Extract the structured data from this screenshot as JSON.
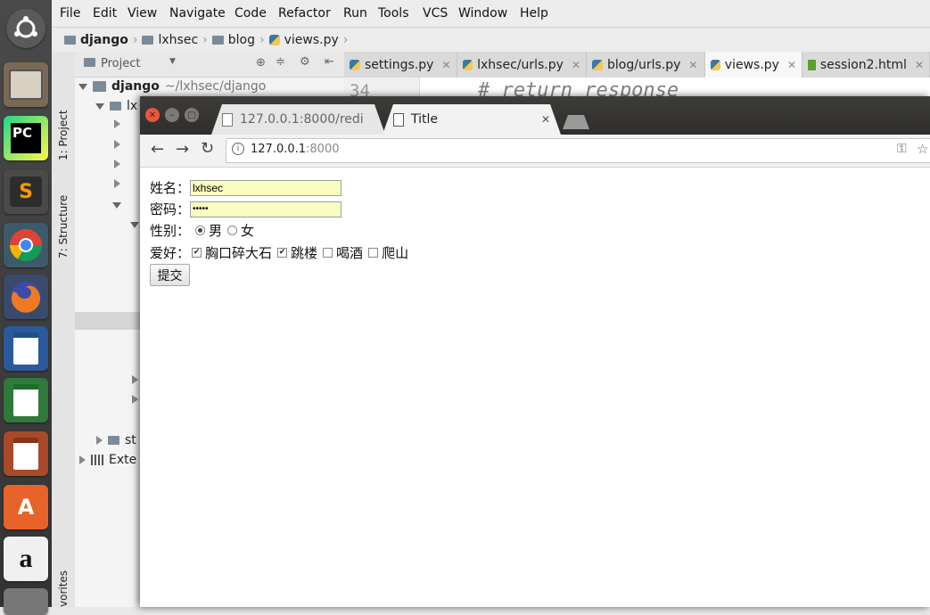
{
  "menubar": {
    "items": [
      "File",
      "Edit",
      "View",
      "Navigate",
      "Code",
      "Refactor",
      "Run",
      "Tools",
      "VCS",
      "Window",
      "Help"
    ]
  },
  "breadcrumb": [
    "django",
    "lxhsec",
    "blog",
    "views.py"
  ],
  "left_strip": {
    "project": "1: Project",
    "structure": "7: Structure",
    "favorites": "vorites"
  },
  "project_panel": {
    "header": "Project",
    "root": "django",
    "root_path": "~/lxhsec/django",
    "child_fragment": "lx",
    "st_fragment": "st",
    "ext_fragment": "Exte"
  },
  "editor": {
    "tabs": [
      {
        "label": "settings.py",
        "icon": "python-file-icon"
      },
      {
        "label": "lxhsec/urls.py",
        "icon": "python-file-icon"
      },
      {
        "label": "blog/urls.py",
        "icon": "python-file-icon"
      },
      {
        "label": "views.py",
        "icon": "python-file-icon",
        "active": true
      },
      {
        "label": "session2.html",
        "icon": "html-file-icon"
      }
    ],
    "line_number": "34",
    "code_line": "# return response"
  },
  "browser": {
    "tabs": [
      {
        "label": "127.0.0.1:8000/redi"
      },
      {
        "label": "Title",
        "active": true
      }
    ],
    "url_host": "127.0.0.1",
    "url_port": ":8000"
  },
  "form": {
    "name_label": "姓名：",
    "name_value": "lxhsec",
    "password_label": "密码：",
    "password_value": "•••••",
    "gender_label": "性别：",
    "gender_options": [
      "男",
      "女"
    ],
    "hobby_label": "爱好：",
    "hobbies": [
      {
        "label": "胸口碎大石",
        "checked": true
      },
      {
        "label": "跳楼",
        "checked": true
      },
      {
        "label": "喝酒",
        "checked": false
      },
      {
        "label": "爬山",
        "checked": false
      }
    ],
    "submit_label": "提交"
  },
  "launcher": {
    "icons": [
      "ubuntu-dash-icon",
      "files-icon",
      "pycharm-icon",
      "sublime-icon",
      "chrome-icon",
      "firefox-icon",
      "writer-icon",
      "calc-icon",
      "impress-icon",
      "software-center-icon",
      "amazon-icon",
      "settings-icon"
    ],
    "pycharm_text": "PC",
    "sublime_text": "S",
    "software_text": "A",
    "amazon_text": "a"
  },
  "colors": {
    "input_autofill": "#fafcc0",
    "launcher_bg": "#3a3a3a",
    "browser_titlebar": "#353431"
  }
}
